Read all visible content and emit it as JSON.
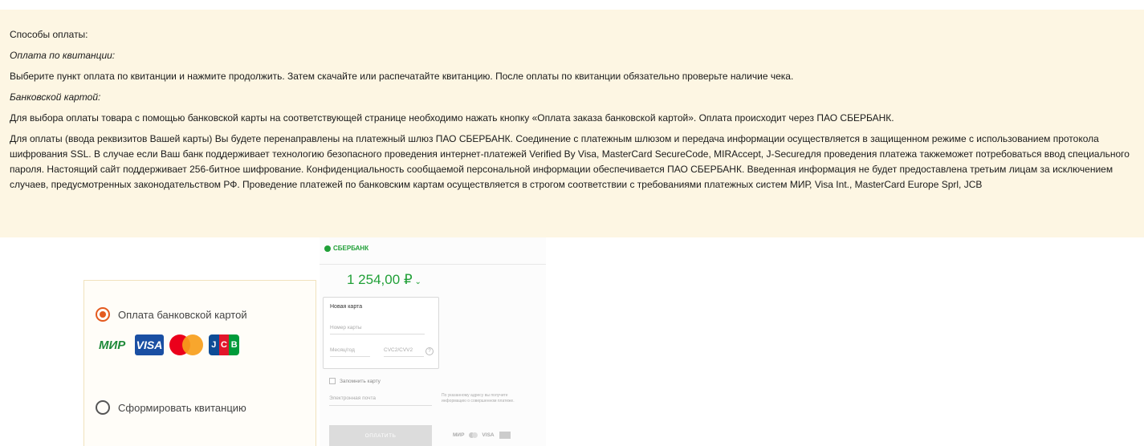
{
  "info": {
    "title": "Способы оплаты:",
    "receipt_heading": "Оплата по квитанции:",
    "receipt_text": "Выберите пункт оплата по квитанции и нажмите продолжить. Затем скачайте или распечатайте квитанцию. После оплаты по квитанции обязательно проверьте наличие чека.",
    "card_heading": "Банковской картой:",
    "card_text": "Для выбора оплаты товара с помощью банковской карты на соответствующей странице необходимо нажать кнопку «Оплата заказа банковской картой». Оплата происходит через ПАО СБЕРБАНК.",
    "security_text": "Для оплаты (ввода реквизитов Вашей карты) Вы будете перенаправлены на платежный шлюз ПАО СБЕРБАНК. Соединение с платежным шлюзом и передача информации осуществляется в защищенном режиме с использованием протокола шифрования SSL. В случае если Ваш банк поддерживает технологию безопасного проведения интернет-платежей Verified By Visa, MasterCard SecureCode, MIRAccept, J-Secureдля проведения платежа такжеможет потребоваться ввод специального пароля. Настоящий сайт поддерживает 256-битное шифрование. Конфиденциальность сообщаемой персональной информации обеспечивается ПАО СБЕРБАНК. Введенная информация не будет предоставлена третьим лицам за исключением случаев, предусмотренных законодательством РФ. Проведение платежей по банковским картам осуществляется в строгом соответствии с требованиями платежных систем МИР, Visa Int., MasterCard Europe Sprl, JCB"
  },
  "payment_options": {
    "card_option": "Оплата банковской картой",
    "receipt_option": "Сформировать квитанцию",
    "selected": "card_option",
    "card_logos": {
      "mir": "МИР",
      "visa": "VISA",
      "jcb": [
        "J",
        "C",
        "B"
      ]
    }
  },
  "pay_form": {
    "bank_name": "СБЕРБАНК",
    "amount": "1 254,00 ₽",
    "new_card_label": "Новая карта",
    "card_number_placeholder": "Номер карты",
    "expiry_placeholder": "Месяц/год",
    "cvc_placeholder": "CVC2/CVV2",
    "help_icon": "?",
    "remember_label": "Запомнить карту",
    "email_placeholder": "Электронная почта",
    "email_note": "По указанному адресу вы получите информацию о совершенном платеже.",
    "pay_button": "ОПЛАТИТЬ",
    "mini_logos": {
      "mir": "МИР",
      "visa": "VISA"
    }
  },
  "colors": {
    "panel_bg": "#fdf6e3",
    "accent_orange": "#e45a1f",
    "sber_green": "#21a038"
  }
}
